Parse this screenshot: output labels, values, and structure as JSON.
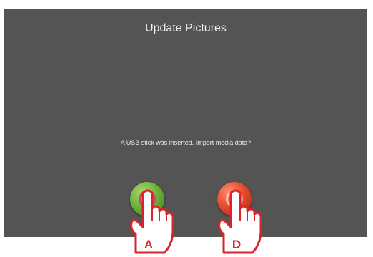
{
  "dialog": {
    "title": "Update Pictures",
    "message": "A USB stick was inserted. Import media data?"
  },
  "buttons": {
    "confirm": {
      "icon": "green-confirm-icon",
      "color": "#6fb33a",
      "marker": "A"
    },
    "cancel": {
      "icon": "red-cancel-icon",
      "color": "#e84a2c",
      "marker": "D"
    }
  },
  "colors": {
    "screen_bg": "#545454",
    "marker": "#d9242b"
  }
}
